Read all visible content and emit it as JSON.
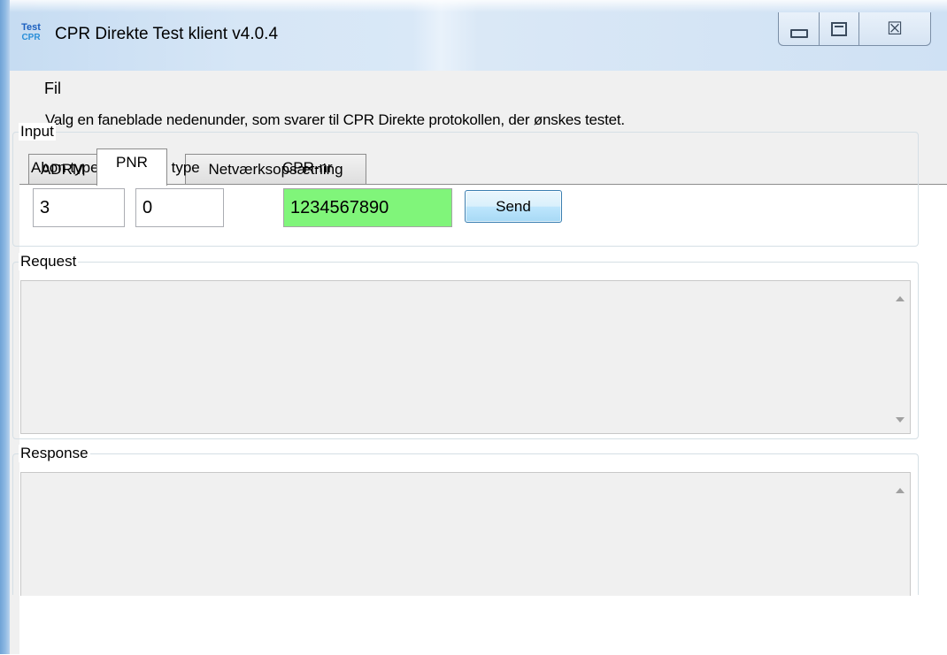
{
  "window": {
    "title": "CPR Direkte Test klient v4.0.4",
    "icon_text_top": "Test",
    "icon_text_bottom": "CPR",
    "controls": [
      "minimize-icon",
      "maximize-icon",
      "close-icon"
    ],
    "close_glyph": "☒"
  },
  "menu": {
    "fil": "Fil"
  },
  "instruction": "Valg en faneblade nedenunder, som svarer til CPR Direkte protokollen, der ønskes testet.",
  "tabs": [
    {
      "label": "ADRM",
      "selected": false
    },
    {
      "label": "PNR",
      "selected": true
    },
    {
      "label": "Netværksopsætning",
      "selected": false
    }
  ],
  "input_group": {
    "legend": "Input",
    "abon_type": {
      "label": "Abon type",
      "value": "3"
    },
    "data_type": {
      "label": "Data type",
      "value": "0"
    },
    "cpr_nr": {
      "label": "CPR-nr",
      "value": "1234567890",
      "background": "#80f57a"
    },
    "send_label": "Send"
  },
  "request_group": {
    "legend": "Request",
    "text": ""
  },
  "response_group": {
    "legend": "Response",
    "text": ""
  }
}
